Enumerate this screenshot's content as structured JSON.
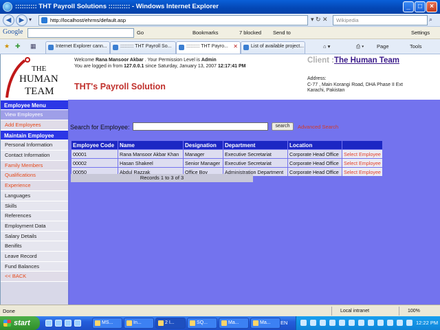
{
  "window": {
    "title": ":::::::::: THT Payroll Solutions :::::::::: - Windows Internet Explorer"
  },
  "address_bar": {
    "url": "http://localhost/ehrms/default.asp",
    "search_placeholder": "Wikipedia"
  },
  "google_bar": {
    "label": "Google",
    "go": "Go",
    "bookmarks": "Bookmarks",
    "blocked": "7 blocked",
    "send_to": "Send to",
    "settings": "Settings"
  },
  "tabs": [
    {
      "label": "Internet Explorer cann...",
      "active": false
    },
    {
      "label": ":::::::::: THT Payroll So...",
      "active": false
    },
    {
      "label": ":::::::::: THT Payro...",
      "active": true
    },
    {
      "label": "List of available project...",
      "active": false
    }
  ],
  "command_bar": {
    "page": "Page",
    "tools": "Tools"
  },
  "header": {
    "logo_text": [
      "THE",
      "HUMAN",
      "TEAM"
    ],
    "welcome_prefix": "Welcome",
    "user": "Rana Mansoor Akbar",
    "permission_text": ". Your Permission Level is",
    "permission_level": "Admin",
    "login_prefix": "You are logged in from",
    "login_ip": "127.0.0.1",
    "login_since": "since Saturday, January 13, 2007",
    "login_time": "12:17:41 PM",
    "app_title": "THT's Payroll Solution",
    "client_label": "Client :",
    "client_name": "The Human Team",
    "address_label": "Address:",
    "address_line1": "C-77 , Main Korangi Road, DHA Phase II Ext",
    "address_line2": "Karachi, Pakistan"
  },
  "sidebar": {
    "employee_menu": "Employee Menu",
    "employee_items": [
      "View Employees",
      "Add Employees"
    ],
    "maintain_menu": "Maintain Employee",
    "maintain_items": [
      "Personal Information",
      "Contact Information",
      "Family Members",
      "Qualifications",
      "Experience",
      "Languages",
      "Skills",
      "References",
      "Employment Data",
      "Salary Details",
      "Benifits",
      "Leave Record",
      "Fund Balances",
      "<< BACK"
    ]
  },
  "search": {
    "label": "Search for Employee:",
    "value": "",
    "button": "search",
    "advanced": "Advanced Search"
  },
  "table": {
    "headers": [
      "Employee Code",
      "Name",
      "Designation",
      "Department",
      "Location",
      ""
    ],
    "rows": [
      [
        "00001",
        "Rana Mansoor Akbar Khan",
        "Manager",
        "Executive Secretariat",
        "Corporate Head Office",
        "Select Employee"
      ],
      [
        "00002",
        "Hasan Shakeel",
        "Senior Manager",
        "Executive Secretariat",
        "Corporate Head Office",
        "Select Employee"
      ],
      [
        "00050",
        "Abdul Razzak",
        "Office Boy",
        "Administration Department",
        "Corporate Head Office",
        "Select Employee"
      ]
    ],
    "records": "Records 1 to 3 of 3"
  },
  "status_bar": {
    "status": "Done",
    "zone": "Local intranet",
    "zoom": "100%"
  },
  "taskbar": {
    "start": "start",
    "tasks": [
      "MS...",
      "In...",
      "2 I...",
      "SQ...",
      "Ma...",
      "Ma..."
    ],
    "language": "EN",
    "clock": "12:22 PM"
  }
}
